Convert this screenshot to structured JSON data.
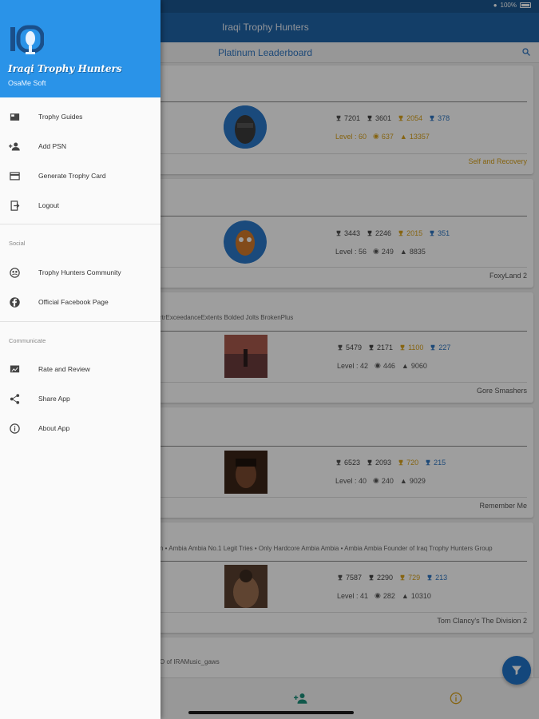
{
  "status": {
    "battery": "100%"
  },
  "appbar": {
    "title": "Iraqi Trophy Hunters"
  },
  "subheader": {
    "title": "Platinum Leaderboard"
  },
  "cards": [
    {
      "platinum": "7201",
      "gold": "3601",
      "silver": "2054",
      "bronze": "378",
      "level": "Level : 60",
      "games": "637",
      "rank": "13357",
      "game": "Self and Recovery",
      "gold_style": true
    },
    {
      "platinum": "3443",
      "gold": "2246",
      "silver": "2015",
      "bronze": "351",
      "level": "Level : 56",
      "games": "249",
      "rank": "8835",
      "game": "FoxyLand 2",
      "gold_style": false
    },
    {
      "about": "rtrExceedanceExtents Bolded Jolts BrokenPlus",
      "platinum": "5479",
      "gold": "2171",
      "silver": "1100",
      "bronze": "227",
      "level": "Level : 42",
      "games": "446",
      "rank": "9060",
      "game": "Gore Smashers",
      "gold_style": false
    },
    {
      "platinum": "6523",
      "gold": "2093",
      "silver": "720",
      "bronze": "215",
      "level": "Level : 40",
      "games": "240",
      "rank": "9029",
      "game": "Remember Me",
      "gold_style": false
    },
    {
      "about": "n • Ambia Ambia No.1 Legit Tries • Only Hardcore Ambia Ambia • Ambia Ambia Founder of Iraq Trophy Hunters Group",
      "platinum": "7587",
      "gold": "2290",
      "silver": "729",
      "bronze": "213",
      "level": "Level : 41",
      "games": "282",
      "rank": "10310",
      "game": "Tom Clancy's The Division 2",
      "gold_style": false
    },
    {
      "about": "O of IRAMusic_gaws"
    }
  ],
  "drawer": {
    "title": "Iraqi Trophy Hunters",
    "subtitle": "OsaMe Soft",
    "items": [
      {
        "label": "Trophy Guides",
        "icon": "book-icon"
      },
      {
        "label": "Add PSN",
        "icon": "add-person-icon"
      },
      {
        "label": "Generate Trophy Card",
        "icon": "card-icon"
      },
      {
        "label": "Logout",
        "icon": "logout-icon"
      }
    ],
    "social_label": "Social",
    "social": [
      {
        "label": "Trophy Hunters Community",
        "icon": "community-icon"
      },
      {
        "label": "Official Facebook Page",
        "icon": "facebook-icon"
      }
    ],
    "communicate_label": "Communicate",
    "communicate": [
      {
        "label": "Rate and Review",
        "icon": "rate-icon"
      },
      {
        "label": "Share App",
        "icon": "share-icon"
      },
      {
        "label": "About App",
        "icon": "info-icon"
      }
    ]
  },
  "colors": {
    "primary": "#2065a9",
    "drawer_header": "#2a93e8",
    "gold": "#d8a21c",
    "blue_trophy": "#2f76c2"
  }
}
